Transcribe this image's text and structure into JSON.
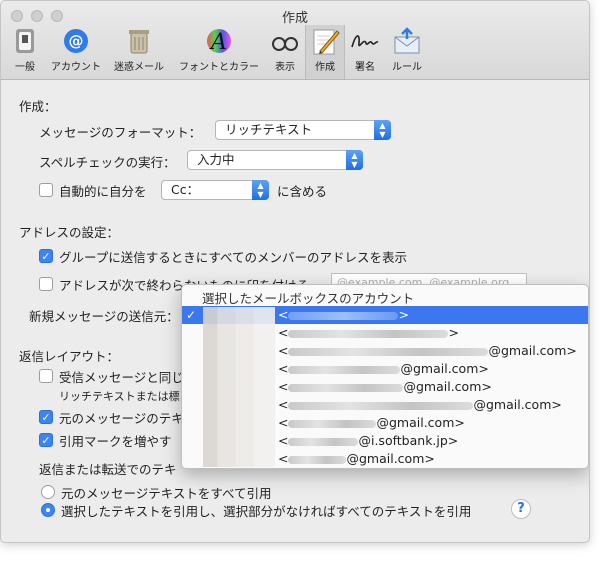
{
  "window": {
    "title": "作成"
  },
  "toolbar": [
    {
      "label": "一般",
      "icon": "general-switch-icon"
    },
    {
      "label": "アカウント",
      "icon": "at-sign-icon"
    },
    {
      "label": "迷惑メール",
      "icon": "junk-trash-icon"
    },
    {
      "label": "フォントとカラー",
      "icon": "font-color-icon"
    },
    {
      "label": "表示",
      "icon": "glasses-icon"
    },
    {
      "label": "作成",
      "icon": "pencil-paper-icon",
      "selected": true
    },
    {
      "label": "署名",
      "icon": "signature-icon"
    },
    {
      "label": "ルール",
      "icon": "rules-envelope-icon"
    }
  ],
  "compose": {
    "heading": "作成：",
    "format_label": "メッセージのフォーマット：",
    "format_value": "リッチテキスト",
    "spell_label": "スペルチェックの実行：",
    "spell_value": "入力中",
    "auto_self_label": "自動的に自分を",
    "auto_self_value": "Cc：",
    "auto_self_suffix": "に含める",
    "auto_self_checked": false
  },
  "address": {
    "heading": "アドレスの設定：",
    "group_label": "グループに送信するときにすべてのメンバーのアドレスを表示",
    "group_checked": true,
    "mark_label": "アドレスが次で終わらないものに印を付ける",
    "mark_checked": false,
    "mark_placeholder": "@example.com, @example.org",
    "from_label": "新規メッセージの送信元："
  },
  "reply": {
    "heading": "返信レイアウト：",
    "same_format_label": "受信メッセージと同じ",
    "same_format_checked": false,
    "note": "リッチテキストまたは標",
    "quote_label": "元のメッセージのテキ",
    "quote_checked": true,
    "increase_label": "引用マークを増やす",
    "increase_checked": true,
    "forward_heading": "返信または転送でのテキ",
    "radio_all": "元のメッセージテキストをすべて引用",
    "radio_selected": "選択したテキストを引用し、選択部分がなければすべてのテキストを引用",
    "selected_radio": "radio_selected",
    "help": "?"
  },
  "menu": {
    "header": "選択したメールボックスのアカウント",
    "items": [
      {
        "prefix": "<",
        "suffix": ">",
        "selected": true,
        "check": "✓"
      },
      {
        "prefix": "<",
        "suffix": ">",
        "selected": false
      },
      {
        "prefix": "<",
        "suffix": "@gmail.com>",
        "selected": false
      },
      {
        "prefix": "<",
        "suffix": "@gmail.com>",
        "selected": false
      },
      {
        "prefix": "<",
        "suffix": "@gmail.com>",
        "selected": false
      },
      {
        "prefix": "<",
        "suffix": "@gmail.com>",
        "selected": false
      },
      {
        "prefix": "<",
        "suffix": "@gmail.com>",
        "selected": false
      },
      {
        "prefix": "<",
        "suffix": "@i.softbank.jp>",
        "selected": false
      },
      {
        "prefix": "<",
        "suffix": "@gmail.com>",
        "selected": false
      }
    ]
  },
  "colors": {
    "accent": "#3b78f0",
    "window_bg": "#ececec"
  }
}
